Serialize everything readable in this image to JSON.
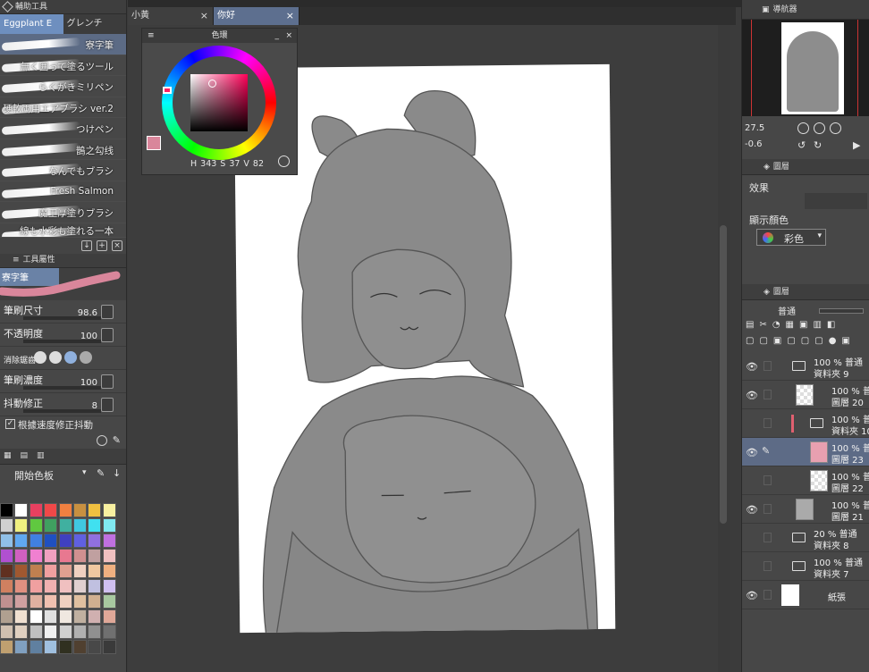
{
  "left_panel": {
    "title": "輔助工具",
    "tabs": [
      "Eggplant E",
      "グレンチ"
    ],
    "brushes": [
      "寮字筆",
      "無く囲って塗るツール",
      "らくがきミリペン",
      "硬軟両用エアブラシ ver.2",
      "つけペン",
      "鵲之勾线",
      "なんでもブラシ",
      "Fresh Salmon",
      "魔王厚塗りブラシ",
      "線も水彩も塗れる一本"
    ],
    "props_title": "工具屬性",
    "brush_name": "寮字筆",
    "params": [
      {
        "label": "筆刷尺寸",
        "value": "98.6"
      },
      {
        "label": "不透明度",
        "value": "100"
      },
      {
        "label": "消除鋸齒",
        "value": ""
      },
      {
        "label": "筆刷濃度",
        "value": "100"
      },
      {
        "label": "抖動修正",
        "value": "8"
      }
    ],
    "checkbox_label": "根據速度修正抖動",
    "palette_name": "開始色板"
  },
  "doc_tabs": [
    "小黃",
    "你好"
  ],
  "color_window": {
    "title": "色環",
    "h": "343",
    "s": "37",
    "v": "82",
    "h_label": "H",
    "s_label": "S",
    "v_label": "V",
    "accent": "#d9869b"
  },
  "right_panel": {
    "zoom": "27.5",
    "rotate": "-0.6",
    "navigator_title": "導航器",
    "layer_props_title": "圖層",
    "effect_label": "效果",
    "display_color_label": "顯示顏色",
    "display_color_value": "彩色",
    "layers_title": "圖層",
    "blend_mode": "普通",
    "layers": [
      {
        "line1": "100 % 普通",
        "line2": "資料夾 9",
        "type": "folder"
      },
      {
        "line1": "100 % 普通",
        "line2": "圖層 20",
        "type": "layer"
      },
      {
        "line1": "100 % 普通",
        "line2": "資料夾 10",
        "type": "folder"
      },
      {
        "line1": "100 % 普通",
        "line2": "圖層 23",
        "type": "layer"
      },
      {
        "line1": "100 % 普通",
        "line2": "圖層 22",
        "type": "layer"
      },
      {
        "line1": "100 % 普通",
        "line2": "圖層 21",
        "type": "layer"
      },
      {
        "line1": "20 % 普通",
        "line2": "資料夾 8",
        "type": "folder"
      },
      {
        "line1": "100 % 普通",
        "line2": "資料夾 7",
        "type": "folder"
      },
      {
        "line1": "",
        "line2": "紙張",
        "type": "paper"
      }
    ]
  }
}
